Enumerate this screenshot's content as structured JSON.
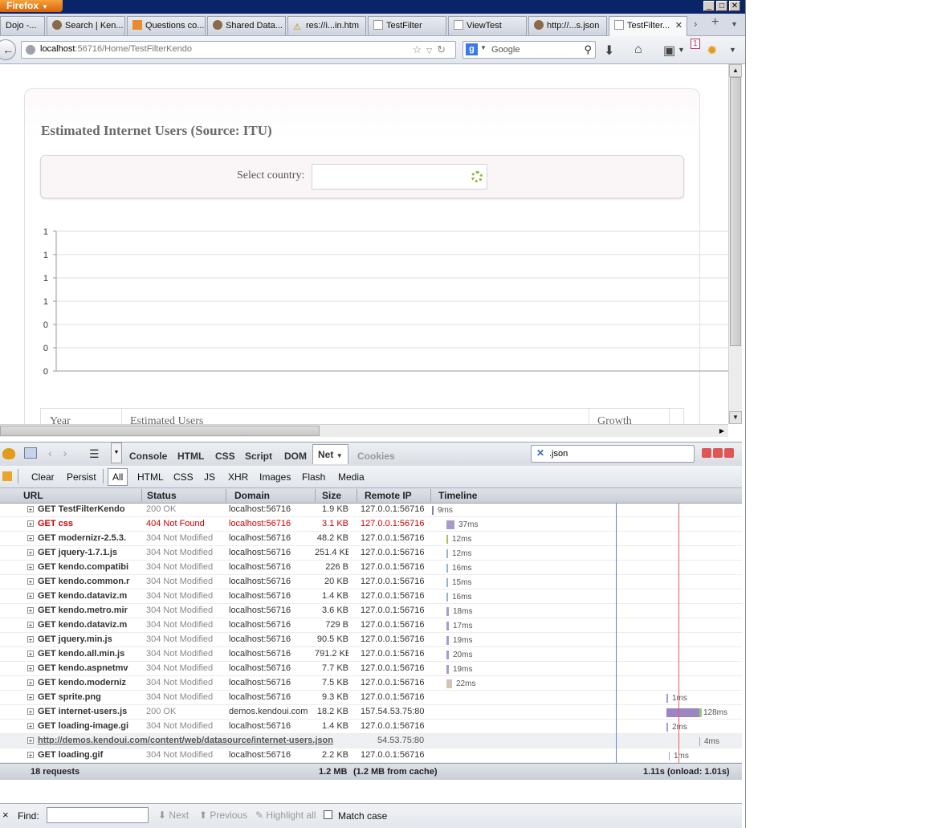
{
  "browser": {
    "app_button": "Firefox",
    "tabs": [
      {
        "label": "Dojo -..."
      },
      {
        "label": "Search | Ken..."
      },
      {
        "label": "Questions co..."
      },
      {
        "label": "Shared Data..."
      },
      {
        "label": "res://i...in.htm"
      },
      {
        "label": "TestFilter"
      },
      {
        "label": "ViewTest"
      },
      {
        "label": "http://...s.json"
      },
      {
        "label": "TestFilter..."
      }
    ],
    "url_host": "localhost",
    "url_rest": ":56716/Home/TestFilterKendo",
    "search_engine": "Google",
    "search_g": "g",
    "badge": "1"
  },
  "page": {
    "title": "Estimated Internet Users (Source: ITU)",
    "select_label": "Select country:",
    "chart_data": {
      "type": "line",
      "y_tick_labels": [
        "1",
        "1",
        "1",
        "1",
        "0",
        "0",
        "0"
      ],
      "series": [],
      "grid": true
    },
    "grid_columns": [
      "Year",
      "Estimated Users",
      "Growth"
    ]
  },
  "firebug": {
    "panels": [
      "Console",
      "HTML",
      "CSS",
      "Script",
      "DOM",
      "Net",
      "Cookies"
    ],
    "active_panel": "Net",
    "filter_text": ".json",
    "net_filters": [
      "Clear",
      "Persist",
      "All",
      "HTML",
      "CSS",
      "JS",
      "XHR",
      "Images",
      "Flash",
      "Media"
    ],
    "columns": [
      "URL",
      "Status",
      "Domain",
      "Size",
      "Remote IP",
      "Timeline"
    ],
    "requests": [
      {
        "url": "GET TestFilterKendo",
        "status": "200 OK",
        "domain": "localhost:56716",
        "size": "1.9 KB",
        "ip": "127.0.0.1:56716",
        "time": "9ms",
        "kind": "ok",
        "tl_color": "#8a7bb5"
      },
      {
        "url": "GET css",
        "status": "404 Not Found",
        "domain": "localhost:56716",
        "size": "3.1 KB",
        "ip": "127.0.0.1:56716",
        "time": "37ms",
        "kind": "err",
        "tl_color": "#a89bc9"
      },
      {
        "url": "GET modernizr-2.5.3.",
        "status": "304 Not Modified",
        "domain": "localhost:56716",
        "size": "48.2 KB",
        "ip": "127.0.0.1:56716",
        "time": "12ms",
        "kind": "nm",
        "tl_color": "#a6c45c"
      },
      {
        "url": "GET jquery-1.7.1.js",
        "status": "304 Not Modified",
        "domain": "localhost:56716",
        "size": "251.4 KB",
        "ip": "127.0.0.1:56716",
        "time": "12ms",
        "kind": "nm",
        "tl_color": "#8fb8c8"
      },
      {
        "url": "GET kendo.compatibi",
        "status": "304 Not Modified",
        "domain": "localhost:56716",
        "size": "226 B",
        "ip": "127.0.0.1:56716",
        "time": "16ms",
        "kind": "nm",
        "tl_color": "#8fb8c8"
      },
      {
        "url": "GET kendo.common.r",
        "status": "304 Not Modified",
        "domain": "localhost:56716",
        "size": "20 KB",
        "ip": "127.0.0.1:56716",
        "time": "15ms",
        "kind": "nm",
        "tl_color": "#8fb8c8"
      },
      {
        "url": "GET kendo.dataviz.m",
        "status": "304 Not Modified",
        "domain": "localhost:56716",
        "size": "1.4 KB",
        "ip": "127.0.0.1:56716",
        "time": "16ms",
        "kind": "nm",
        "tl_color": "#8fb8c8"
      },
      {
        "url": "GET kendo.metro.mir",
        "status": "304 Not Modified",
        "domain": "localhost:56716",
        "size": "3.6 KB",
        "ip": "127.0.0.1:56716",
        "time": "18ms",
        "kind": "nm",
        "tl_color": "#a89bc9"
      },
      {
        "url": "GET kendo.dataviz.m",
        "status": "304 Not Modified",
        "domain": "localhost:56716",
        "size": "729 B",
        "ip": "127.0.0.1:56716",
        "time": "17ms",
        "kind": "nm",
        "tl_color": "#a89bc9"
      },
      {
        "url": "GET jquery.min.js",
        "status": "304 Not Modified",
        "domain": "localhost:56716",
        "size": "90.5 KB",
        "ip": "127.0.0.1:56716",
        "time": "19ms",
        "kind": "nm",
        "tl_color": "#a89bc9"
      },
      {
        "url": "GET kendo.all.min.js",
        "status": "304 Not Modified",
        "domain": "localhost:56716",
        "size": "791.2 KB",
        "ip": "127.0.0.1:56716",
        "time": "20ms",
        "kind": "nm",
        "tl_color": "#a89bc9"
      },
      {
        "url": "GET kendo.aspnetmv",
        "status": "304 Not Modified",
        "domain": "localhost:56716",
        "size": "7.7 KB",
        "ip": "127.0.0.1:56716",
        "time": "19ms",
        "kind": "nm",
        "tl_color": "#a89bc9"
      },
      {
        "url": "GET kendo.moderniz",
        "status": "304 Not Modified",
        "domain": "localhost:56716",
        "size": "7.5 KB",
        "ip": "127.0.0.1:56716",
        "time": "22ms",
        "kind": "nm",
        "tl_color": "#d3c3b8"
      },
      {
        "url": "GET sprite.png",
        "status": "304 Not Modified",
        "domain": "localhost:56716",
        "size": "9.3 KB",
        "ip": "127.0.0.1:56716",
        "time": "1ms",
        "kind": "nm",
        "tl_color": "#a89bc9"
      },
      {
        "url": "GET internet-users.js",
        "status": "200 OK",
        "domain": "demos.kendoui.com",
        "size": "18.2 KB",
        "ip": "157.54.53.75:80",
        "time": "128ms",
        "kind": "ok",
        "tl_color": "#9b86c2"
      },
      {
        "url": "GET loading-image.gi",
        "status": "304 Not Modified",
        "domain": "localhost:56716",
        "size": "1.4 KB",
        "ip": "127.0.0.1:56716",
        "time": "2ms",
        "kind": "nm",
        "tl_color": "#a89bc9"
      },
      {
        "url": "http://demos.kendoui.com/content/web/datasource/internet-users.json",
        "status": "",
        "domain": "",
        "size": "",
        "ip": "54.53.75:80",
        "time": "4ms",
        "kind": "link",
        "tl_color": "#a89bc9"
      },
      {
        "url": "GET loading.gif",
        "status": "304 Not Modified",
        "domain": "localhost:56716",
        "size": "2.2 KB",
        "ip": "127.0.0.1:56716",
        "time": "1ms",
        "kind": "nm",
        "tl_color": "#a89bc9"
      }
    ],
    "summary": {
      "count": "18 requests",
      "size": "1.2 MB",
      "cache": "(1.2 MB from cache)",
      "time": "1.11s (onload: 1.01s)"
    }
  },
  "findbar": {
    "close": "×",
    "label": "Find:",
    "next": "Next",
    "previous": "Previous",
    "highlight": "Highlight all",
    "match_case": "Match case"
  },
  "colors": {
    "titlebar": "#0a246a",
    "firefox_orange": "#e2811f",
    "error_red": "#cc0000"
  }
}
